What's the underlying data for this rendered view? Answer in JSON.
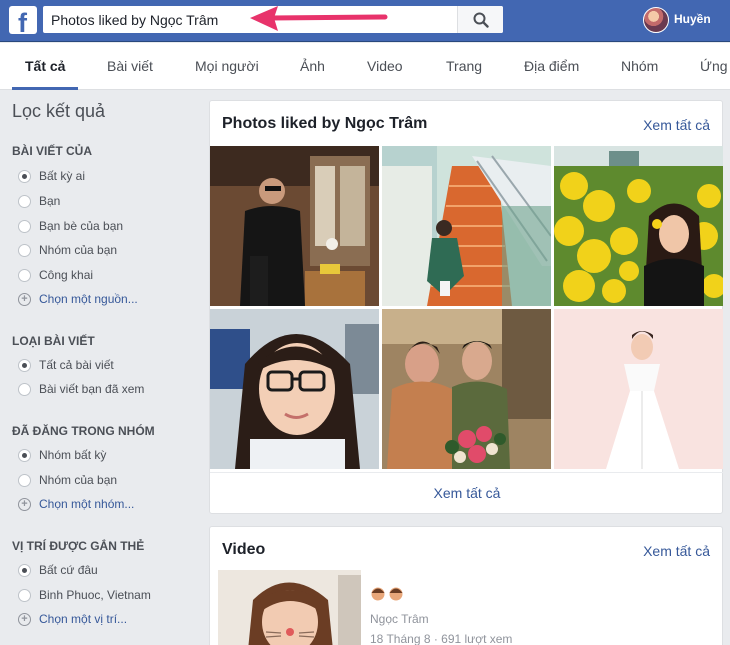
{
  "topbar": {
    "logo_letter": "f",
    "search": {
      "value": "Photos liked by Ngọc Trâm",
      "placeholder": ""
    },
    "profile_name": "Huyền"
  },
  "tabs": [
    {
      "label": "Tất cả",
      "active": true
    },
    {
      "label": "Bài viết"
    },
    {
      "label": "Mọi người"
    },
    {
      "label": "Ảnh"
    },
    {
      "label": "Video"
    },
    {
      "label": "Trang"
    },
    {
      "label": "Địa điểm"
    },
    {
      "label": "Nhóm"
    },
    {
      "label": "Ứng"
    }
  ],
  "filters": {
    "title": "Lọc kết quả",
    "sections": [
      {
        "title": "BÀI VIẾT CỦA",
        "options": [
          "Bất kỳ ai",
          "Bạn",
          "Bạn bè của bạn",
          "Nhóm của bạn",
          "Công khai"
        ],
        "selected": 0,
        "more": "Chọn một nguồn..."
      },
      {
        "title": "LOẠI BÀI VIẾT",
        "options": [
          "Tất cả bài viết",
          "Bài viết bạn đã xem"
        ],
        "selected": 0
      },
      {
        "title": "ĐÃ ĐĂNG TRONG NHÓM",
        "options": [
          "Nhóm bất kỳ",
          "Nhóm của bạn"
        ],
        "selected": 0,
        "more": "Chọn một nhóm..."
      },
      {
        "title": "VỊ TRÍ ĐƯỢC GẮN THẺ",
        "options": [
          "Bất cứ đâu",
          "Binh Phuoc, Vietnam"
        ],
        "selected": 0,
        "more": "Chọn một vị trí..."
      }
    ]
  },
  "photos_card": {
    "title": "Photos liked by Ngọc Trâm",
    "see_all_top": "Xem tất cả",
    "see_all_bottom": "Xem tất cả"
  },
  "video_card": {
    "title": "Video",
    "see_all": "Xem tất cả",
    "author": "Ngọc Trâm",
    "meta": "18 Tháng 8 · 691 lượt xem"
  },
  "colors": {
    "brand_blue": "#4267b2",
    "link_blue": "#365899",
    "annotation_arrow": "#e8336b"
  }
}
